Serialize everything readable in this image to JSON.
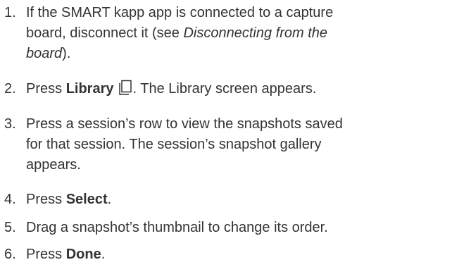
{
  "steps": [
    {
      "number": "1.",
      "line1": "If the SMART kapp app is connected to a capture",
      "line2_pre": "board, disconnect it (see ",
      "line2_italic": "Disconnecting from the",
      "line3_italic": "board",
      "line3_post": ")."
    },
    {
      "number": "2.",
      "pre": "Press ",
      "bold": "Library",
      "icon": "library-icon",
      "post": ". The Library screen appears."
    },
    {
      "number": "3.",
      "line1": "Press a session’s row to view the snapshots saved",
      "line2": "for that session. The session’s snapshot gallery",
      "line3": "appears."
    },
    {
      "number": "4.",
      "pre": "Press ",
      "bold": "Select",
      "post": "."
    },
    {
      "number": "5.",
      "text": "Drag a snapshot’s thumbnail to change its order."
    },
    {
      "number": "6.",
      "pre": "Press ",
      "bold": "Done",
      "post": "."
    }
  ]
}
